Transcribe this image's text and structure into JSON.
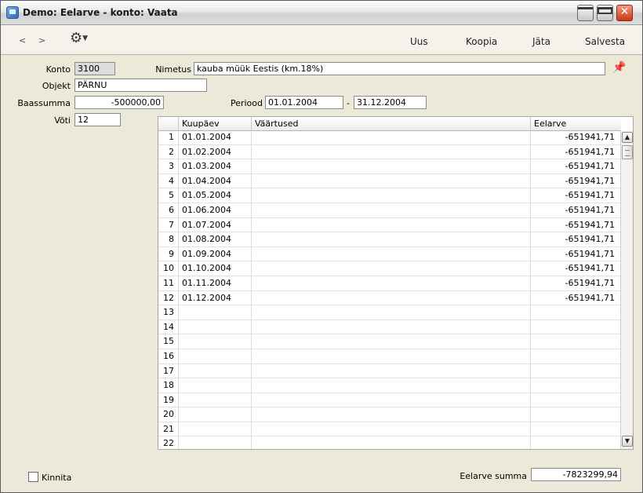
{
  "window": {
    "title": "Demo: Eelarve - konto: Vaata",
    "minimize_glyph": "minimize",
    "maximize_glyph": "maximize",
    "close_glyph": "✕"
  },
  "toolbar": {
    "back": "<",
    "forward": ">",
    "settings_icon": "gear-icon",
    "new": "Uus",
    "copy": "Koopia",
    "leave": "Jäta",
    "save": "Salvesta"
  },
  "form": {
    "konto_label": "Konto",
    "konto_value": "3100",
    "nimetus_label": "Nimetus",
    "nimetus_value": "kauba müük Eestis (km.18%)",
    "objekt_label": "Objekt",
    "objekt_value": "PÄRNU",
    "baassumma_label": "Baassumma",
    "baassumma_value": "-500000,00",
    "periood_label": "Periood",
    "periood_from": "01.01.2004",
    "periood_sep": "-",
    "periood_to": "31.12.2004",
    "voti_label": "Võti",
    "voti_value": "12"
  },
  "grid": {
    "headers": [
      "",
      "Kuupäev",
      "Väärtused",
      "Eelarve"
    ],
    "rows": [
      {
        "n": "1",
        "date": "01.01.2004",
        "value": "",
        "budget": "-651941,71"
      },
      {
        "n": "2",
        "date": "01.02.2004",
        "value": "",
        "budget": "-651941,71"
      },
      {
        "n": "3",
        "date": "01.03.2004",
        "value": "",
        "budget": "-651941,71"
      },
      {
        "n": "4",
        "date": "01.04.2004",
        "value": "",
        "budget": "-651941,71"
      },
      {
        "n": "5",
        "date": "01.05.2004",
        "value": "",
        "budget": "-651941,71"
      },
      {
        "n": "6",
        "date": "01.06.2004",
        "value": "",
        "budget": "-651941,71"
      },
      {
        "n": "7",
        "date": "01.07.2004",
        "value": "",
        "budget": "-651941,71"
      },
      {
        "n": "8",
        "date": "01.08.2004",
        "value": "",
        "budget": "-651941,71"
      },
      {
        "n": "9",
        "date": "01.09.2004",
        "value": "",
        "budget": "-651941,71"
      },
      {
        "n": "10",
        "date": "01.10.2004",
        "value": "",
        "budget": "-651941,71"
      },
      {
        "n": "11",
        "date": "01.11.2004",
        "value": "",
        "budget": "-651941,71"
      },
      {
        "n": "12",
        "date": "01.12.2004",
        "value": "",
        "budget": "-651941,71"
      },
      {
        "n": "13",
        "date": "",
        "value": "",
        "budget": ""
      },
      {
        "n": "14",
        "date": "",
        "value": "",
        "budget": ""
      },
      {
        "n": "15",
        "date": "",
        "value": "",
        "budget": ""
      },
      {
        "n": "16",
        "date": "",
        "value": "",
        "budget": ""
      },
      {
        "n": "17",
        "date": "",
        "value": "",
        "budget": ""
      },
      {
        "n": "18",
        "date": "",
        "value": "",
        "budget": ""
      },
      {
        "n": "19",
        "date": "",
        "value": "",
        "budget": ""
      },
      {
        "n": "20",
        "date": "",
        "value": "",
        "budget": ""
      },
      {
        "n": "21",
        "date": "",
        "value": "",
        "budget": ""
      },
      {
        "n": "22",
        "date": "",
        "value": "",
        "budget": ""
      }
    ]
  },
  "footer": {
    "kinnita_label": "Kinnita",
    "kinnita_checked": false,
    "summa_label": "Eelarve summa",
    "summa_value": "-7823299,94"
  }
}
